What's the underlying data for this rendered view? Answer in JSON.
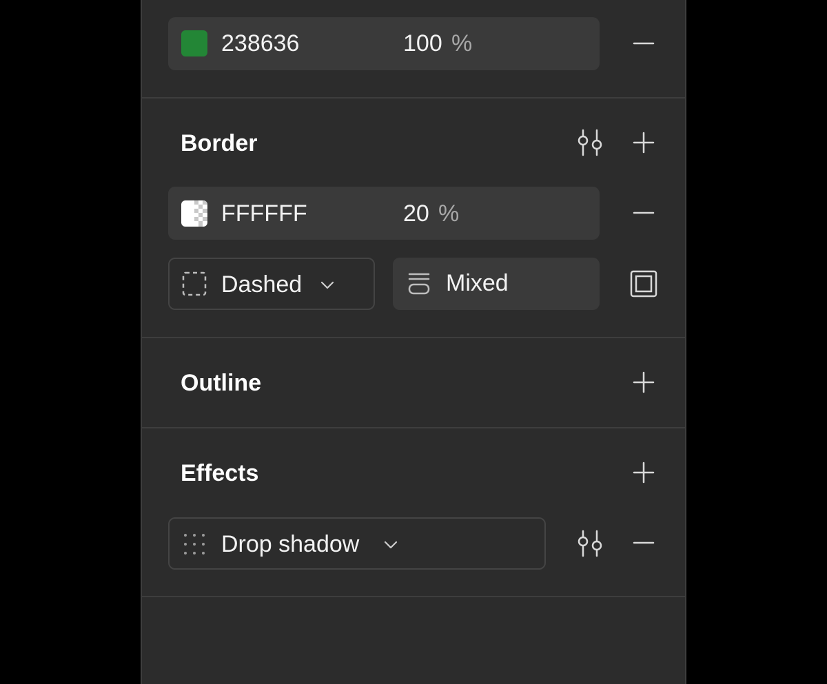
{
  "fill": {
    "color_hex": "238636",
    "swatch_color": "#238636",
    "opacity_value": "100",
    "opacity_unit": "%"
  },
  "border": {
    "title": "Border",
    "color_hex": "FFFFFF",
    "swatch_color": "#FFFFFF",
    "opacity_value": "20",
    "opacity_unit": "%",
    "style_label": "Dashed",
    "width_label": "Mixed"
  },
  "outline": {
    "title": "Outline"
  },
  "effects": {
    "title": "Effects",
    "effect_label": "Drop shadow"
  },
  "icons": {
    "settings": "sliders-icon",
    "add": "plus-icon",
    "remove": "minus-icon",
    "dashed": "dashed-square-icon",
    "stroke_width": "stroke-weight-icon",
    "inside": "border-inside-icon",
    "drag": "drag-handle-icon",
    "chevron": "chevron-down-icon"
  }
}
